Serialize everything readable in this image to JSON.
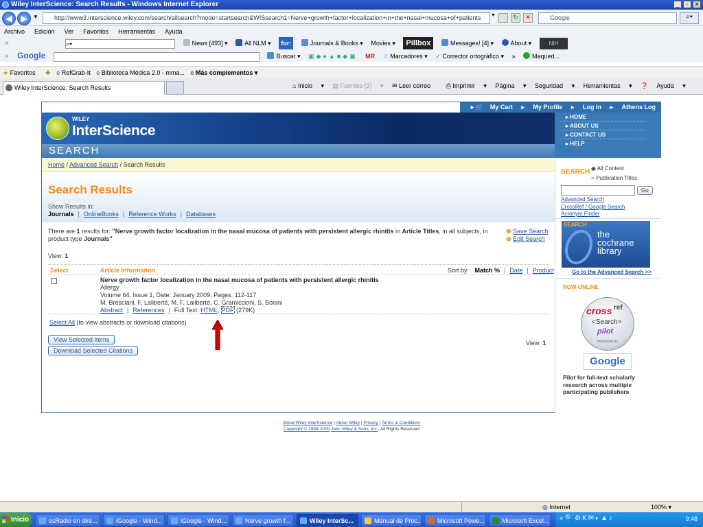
{
  "window": {
    "title": "Wiley InterScience: Search Results - Windows Internet Explorer"
  },
  "browser": {
    "url": "http://www3.interscience.wiley.com/search/allsearch?mode=startsearch&WISsearch1=Nerve+growth+factor+localization+in+the+nasal+mucosa+of+patients",
    "search_placeholder": "Google",
    "menu": [
      "Archivo",
      "Edición",
      "Ver",
      "Favoritos",
      "Herramientas",
      "Ayuda"
    ],
    "toolbar1": [
      "News [493]",
      "All NLM",
      "for:",
      "Journals & Books",
      "Movies",
      "Pillbox",
      "Messages! [4]",
      "About",
      "NIH"
    ],
    "toolbar2_label": "Google",
    "toolbar2": [
      "Buscar",
      "MR",
      "Marcadores",
      "Corrector ortográfico",
      "Maqued..."
    ],
    "favorites_label": "Favoritos",
    "favorites": [
      "RefGrab-It",
      "Biblioteca Médica 2.0 - mma...",
      "Más complementos"
    ],
    "tab_title": "Wiley InterScience: Search Results",
    "commands": [
      "Inicio",
      "Fuentes (3)",
      "Leer correo",
      "Imprimir",
      "Página",
      "Seguridad",
      "Herramientas",
      "Ayuda"
    ]
  },
  "site": {
    "topnav": [
      "My Cart",
      "My Profile",
      "Log In",
      "Athens Log In"
    ],
    "logo_wiley": "WILEY",
    "logo_name": "InterScience",
    "search_band": "SEARCH",
    "sidenav": [
      "HOME",
      "ABOUT US",
      "CONTACT US",
      "HELP"
    ],
    "breadcrumb": {
      "home": "Home",
      "advanced": "Advanced Search",
      "current": "/ Search Results"
    },
    "heading": "Search Results",
    "show_results_label": "Show Results in:",
    "result_tabs": [
      "Journals",
      "OnlineBooks",
      "Reference Works",
      "Databases"
    ],
    "summary_pre": "There are",
    "summary_count": "1",
    "summary_mid": "results for:",
    "summary_query": "\"Nerve growth factor localization in the nasal mucosa of patients with persistent allergic rhinitis",
    "summary_in": "in",
    "summary_field": "Article Titles",
    "summary_scope": "in all subjects",
    "summary_type_pre": ", in product type",
    "summary_type": "Journals\"",
    "save_search": "Save Search",
    "edit_search": "Edit Search",
    "view_label": "View:",
    "view_value": "1",
    "col_select": "Select",
    "col_info": "Article Information",
    "sort_label": "Sort by:",
    "sort_options": [
      "Match %",
      "Date",
      "Product"
    ],
    "result": {
      "title": "Nerve growth factor localization in the nasal mucosa of patients with persistent allergic rhinitis",
      "journal": "Allergy",
      "details": "Volume 64, Issue 1, Date: January 2009, Pages: 112-117",
      "authors": "M. Bresciani, F. Laliberté, M. F. Laliberté, C. Gramiccioni, S. Bonini",
      "abstract": "Abstract",
      "references": "References",
      "fulltext_label": "Full Text:",
      "html": "HTML",
      "pdf": "PDF",
      "pdf_size": "(279K)"
    },
    "select_all": "Select All",
    "select_all_hint": "(to view abstracts or download citations)",
    "btn_view": "View Selected Items",
    "btn_download": "Download Selected Citations",
    "right": {
      "search_label": "SEARCH",
      "opt_all": "All Content",
      "opt_pub": "Publication Titles",
      "go": "Go",
      "links": [
        "Advanced Search",
        "CrossRef / Google Search",
        "Acronym Finder"
      ],
      "cochrane_label": "SEARCH",
      "cochrane_lines": [
        "the",
        "cochrane",
        "library"
      ],
      "cochrane_link": "Go to the Advanced Search >>",
      "now_online": "NOW ONLINE",
      "crossref_cross": "cross",
      "crossref_ref": "ref",
      "crossref_search": "<Search>",
      "crossref_pilot": "pilot",
      "crossref_powered": "POWERED BY",
      "crossref_google": "Google",
      "pilot_text": "Pilot for full-text scholarly research across multiple participating publishers"
    },
    "footer_links": [
      "About Wiley InterScience",
      "About Wiley",
      "Privacy",
      "Terms & Conditions"
    ],
    "footer_copy": "Copyright © 1999-2009",
    "footer_company": "John Wiley & Sons, Inc.",
    "footer_rights": "All Rights Reserved"
  },
  "status": {
    "zone": "Internet",
    "zoom": "100%"
  },
  "taskbar": {
    "start": "Inicio",
    "items": [
      "esRadio en dire...",
      "iGoogle - Wind...",
      "iGoogle - Wind...",
      "Nerve growth f...",
      "Wiley InterSc...",
      "Manual de Proc...",
      "Microsoft Powe...",
      "Microsoft Excel..."
    ],
    "clock": "9:48"
  },
  "colors": {
    "accent_orange": "#f38a12",
    "link_blue": "#1f4f9c",
    "wiley_blue": "#2f6fae",
    "arrow_red": "#d40000"
  }
}
